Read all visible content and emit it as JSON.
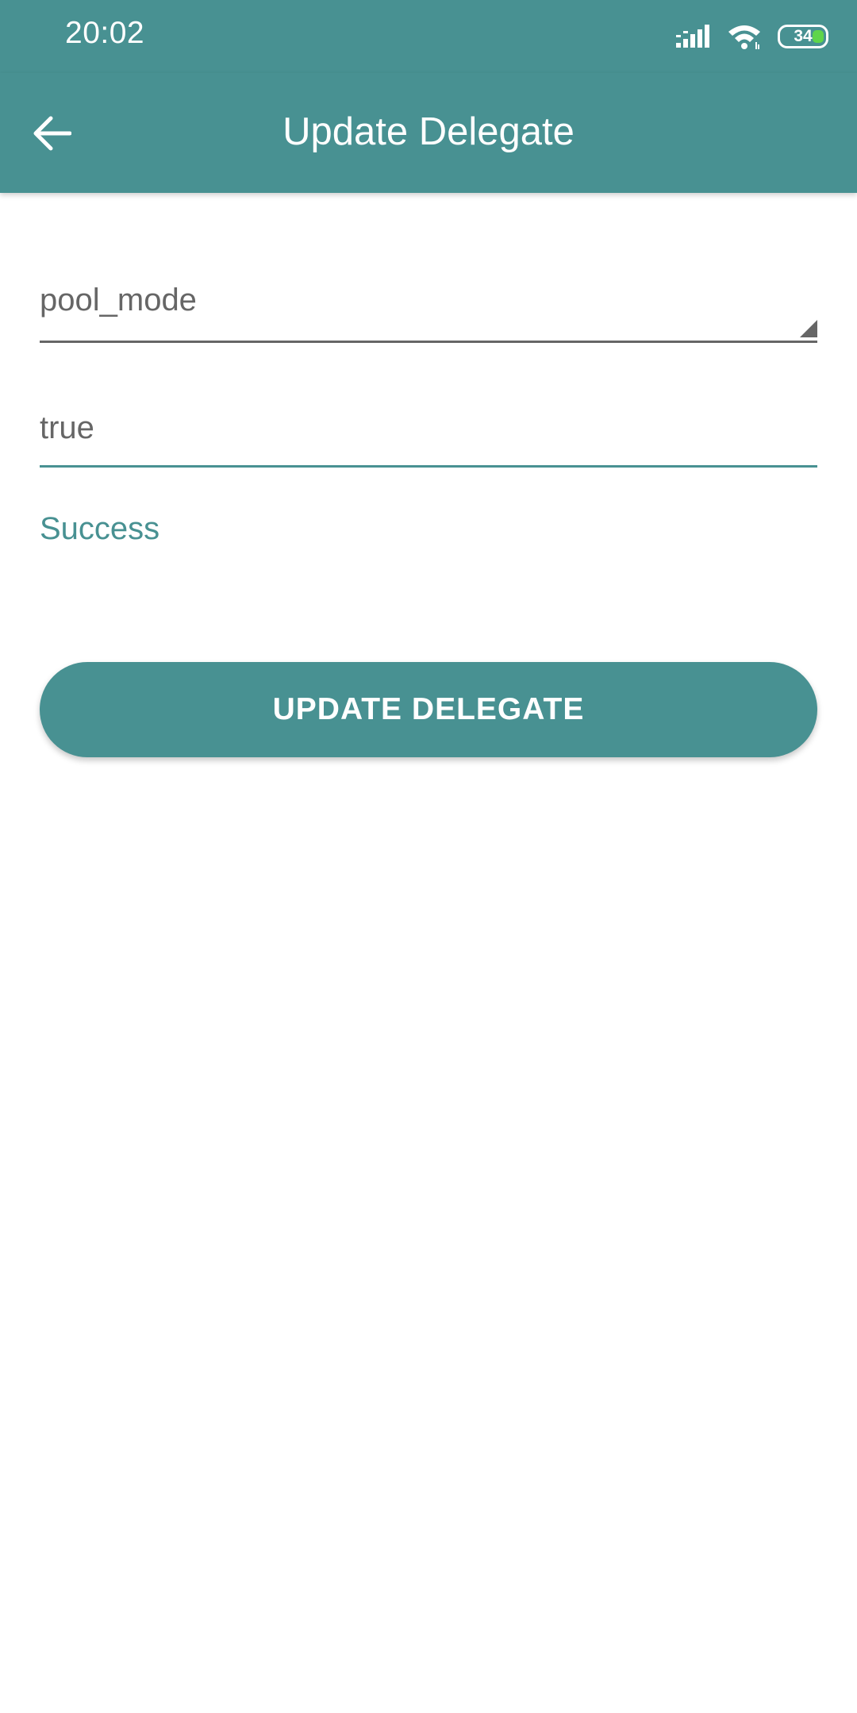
{
  "status_bar": {
    "time": "20:02",
    "battery_level": "34",
    "icons": [
      "signal-icon",
      "wifi-icon",
      "battery-icon"
    ]
  },
  "app_bar": {
    "back_icon": "arrow-left-icon",
    "title": "Update Delegate"
  },
  "form": {
    "spinner_value": "pool_mode",
    "input_value": "true",
    "result": "Success",
    "button_label": "UPDATE DELEGATE"
  },
  "colors": {
    "primary": "#489192",
    "text_gray": "#666666",
    "battery_green": "#5fd54a"
  }
}
